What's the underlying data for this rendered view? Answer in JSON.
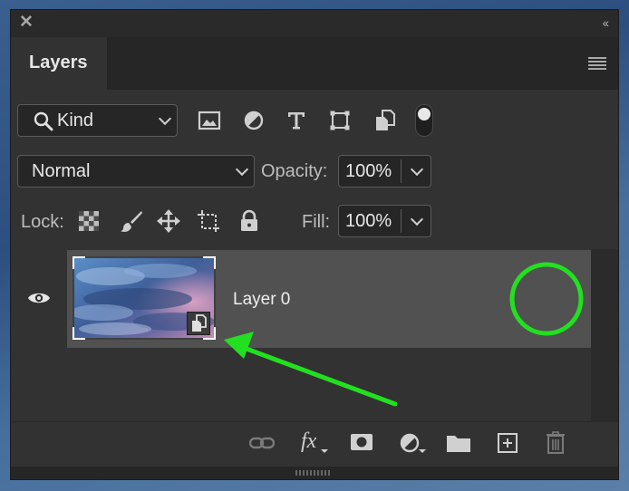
{
  "panel": {
    "tab_label": "Layers",
    "collapse_glyph": "‹‹"
  },
  "filter": {
    "kind_label": "Kind",
    "icons": [
      "image-filter-icon",
      "adjustment-filter-icon",
      "type-filter-icon",
      "shape-filter-icon",
      "smart-object-filter-icon",
      "filter-toggle-switch"
    ]
  },
  "blend": {
    "mode_value": "Normal",
    "opacity_label": "Opacity:",
    "opacity_value": "100%"
  },
  "lock": {
    "label": "Lock:",
    "fill_label": "Fill:",
    "fill_value": "100%"
  },
  "layers": [
    {
      "name": "Layer 0",
      "visible": true,
      "smart_object": true,
      "selected": true
    }
  ],
  "annotation": {
    "color": "#22e01f"
  },
  "bottom_tools": [
    "link-layers-icon",
    "fx-icon",
    "add-mask-icon",
    "new-adjustment-icon",
    "new-group-icon",
    "new-layer-icon",
    "delete-layer-icon"
  ],
  "fx_label": "fx"
}
